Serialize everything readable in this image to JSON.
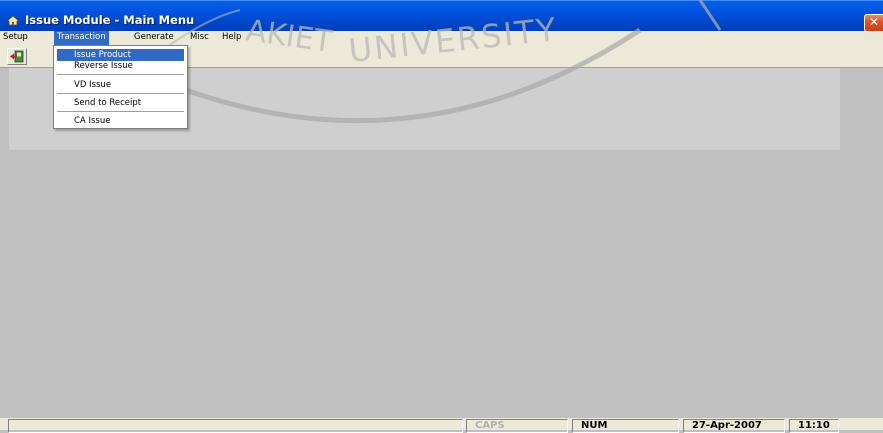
{
  "window": {
    "title": "Issue Module - Main Menu",
    "close_glyph": "✕",
    "icon": "app-icon"
  },
  "menubar": {
    "items": [
      {
        "label": "Setup"
      },
      {
        "label": "Transaction"
      },
      {
        "label": "Generate"
      },
      {
        "label": "Misc"
      },
      {
        "label": "Help"
      }
    ],
    "active": "Transaction"
  },
  "toolbar": {
    "exit_icon": "exit-door-icon"
  },
  "dropdown": {
    "items": [
      {
        "label": "Issue Product"
      },
      {
        "label": "Reverse Issue"
      },
      {
        "label": "VD Issue"
      },
      {
        "label": "Send to Receipt"
      },
      {
        "label": "CA Issue"
      }
    ],
    "selected": "Issue Product"
  },
  "statusbar": {
    "caps": "CAPS",
    "num": "NUM",
    "date": "27-Apr-2007",
    "time": "11:10"
  },
  "colors": {
    "titlebar": "#0054e3",
    "menu_highlight": "#316ac5",
    "chrome": "#ece9d8",
    "workspace": "#c0c0c0"
  }
}
